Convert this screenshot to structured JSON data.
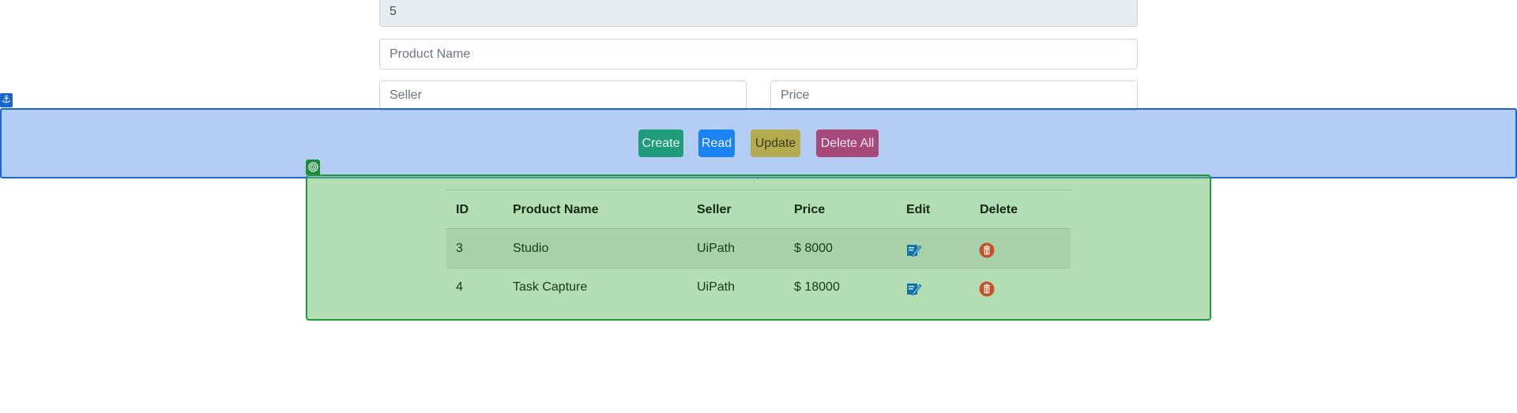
{
  "form": {
    "id_value": "5",
    "product_name_placeholder": "Product Name",
    "seller_placeholder": "Seller",
    "price_placeholder": "Price"
  },
  "buttons": {
    "create": "Create",
    "read": "Read",
    "update": "Update",
    "delete_all": "Delete All"
  },
  "colors": {
    "create": "#1f9c79",
    "read": "#1a84f5",
    "update": "#b4aa4e",
    "delete_all": "#a6487a",
    "anchor_overlay": "#1a66cc",
    "target_overlay": "#1f9a3c",
    "edit_icon": "#1572a8",
    "delete_icon": "#c0532c"
  },
  "table": {
    "headers": [
      "ID",
      "Product Name",
      "Seller",
      "Price",
      "Edit",
      "Delete"
    ],
    "rows": [
      {
        "id": "3",
        "product_name": "Studio",
        "seller": "UiPath",
        "price": "$ 8000",
        "edit_icon": "edit-icon",
        "delete_icon": "trash-icon"
      },
      {
        "id": "4",
        "product_name": "Task Capture",
        "seller": "UiPath",
        "price": "$ 18000",
        "edit_icon": "edit-icon",
        "delete_icon": "trash-icon"
      }
    ]
  },
  "overlays": {
    "anchor_icon": "anchor-icon",
    "target_icon": "target-icon"
  }
}
